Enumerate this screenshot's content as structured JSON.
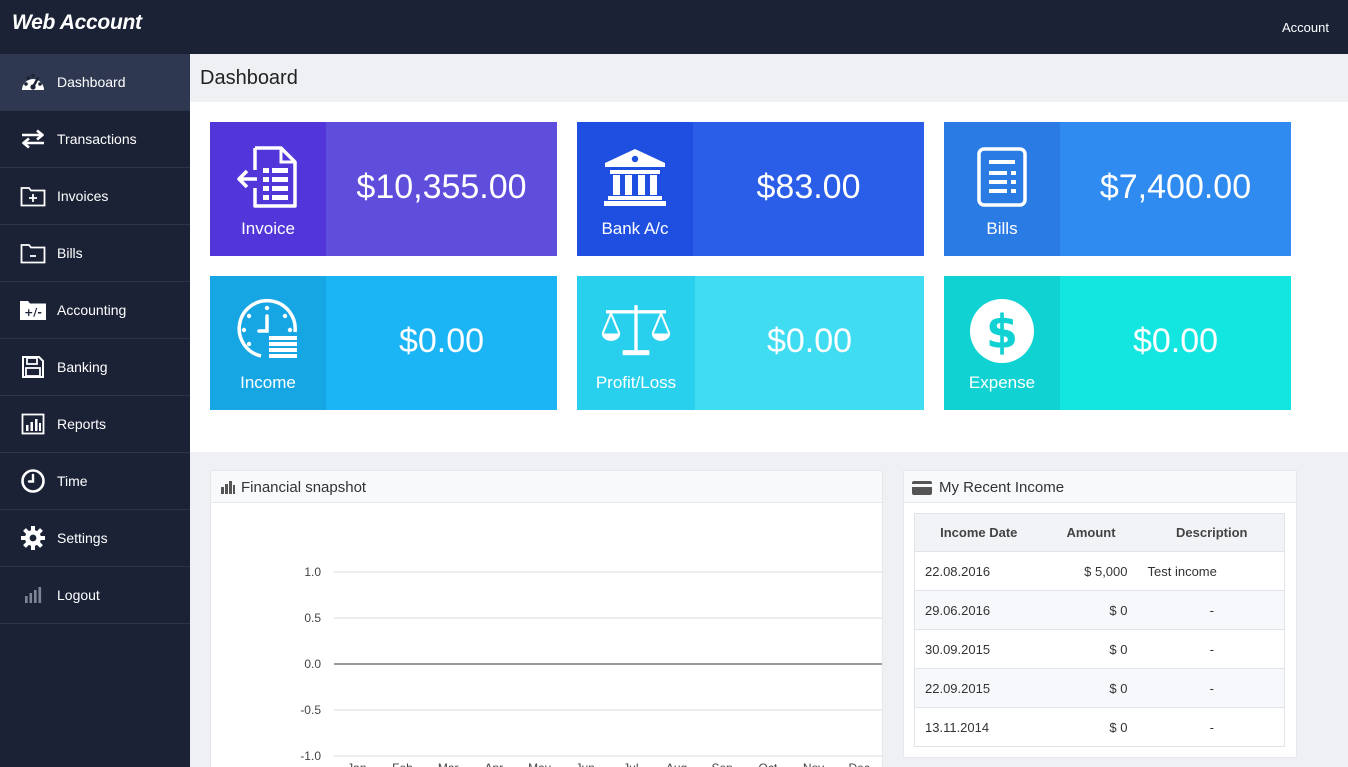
{
  "app": {
    "logo": "Web Account",
    "account_label": "Account"
  },
  "sidebar": {
    "items": [
      {
        "label": "Dashboard",
        "icon": "dashboard-gauge-icon",
        "active": true
      },
      {
        "label": "Transactions",
        "icon": "transfer-arrows-icon"
      },
      {
        "label": "Invoices",
        "icon": "folder-plus-icon"
      },
      {
        "label": "Bills",
        "icon": "folder-minus-icon"
      },
      {
        "label": "Accounting",
        "icon": "plus-minus-folder-icon"
      },
      {
        "label": "Banking",
        "icon": "floppy-disk-icon"
      },
      {
        "label": "Reports",
        "icon": "bar-chart-icon"
      },
      {
        "label": "Time",
        "icon": "clock-icon"
      },
      {
        "label": "Settings",
        "icon": "gear-icon"
      },
      {
        "label": "Logout",
        "icon": "signal-bars-icon"
      }
    ]
  },
  "page": {
    "title": "Dashboard"
  },
  "tiles": [
    {
      "label": "Invoice",
      "value": "$10,355.00",
      "icon": "invoice-document-icon",
      "left_color": "#5236d9",
      "right_color": "#5f4ddb"
    },
    {
      "label": "Bank A/c",
      "value": "$83.00",
      "icon": "bank-building-icon",
      "left_color": "#1f4fe0",
      "right_color": "#2a5ee8"
    },
    {
      "label": "Bills",
      "value": "$7,400.00",
      "icon": "bill-document-icon",
      "left_color": "#2b7be4",
      "right_color": "#2f8bf0"
    },
    {
      "label": "Income",
      "value": "$0.00",
      "icon": "clock-stack-icon",
      "left_color": "#17a6e4",
      "right_color": "#1bb5f6"
    },
    {
      "label": "Profit/Loss",
      "value": "$0.00",
      "icon": "balance-scale-icon",
      "left_color": "#29d0ee",
      "right_color": "#3fdcf2"
    },
    {
      "label": "Expense",
      "value": "$0.00",
      "icon": "dollar-coin-icon",
      "left_color": "#10d2d2",
      "right_color": "#13e6e0"
    }
  ],
  "snapshot": {
    "title": "Financial snapshot",
    "icon": "bar-chart-icon",
    "chart_data": {
      "type": "line",
      "y_ticks": [
        "1.0",
        "0.5",
        "0.0",
        "-0.5",
        "-1.0"
      ],
      "ylim": [
        -1.0,
        1.0
      ],
      "categories": [
        "Jan",
        "Feb",
        "Mar",
        "Apr",
        "May",
        "Jun",
        "Jul",
        "Aug",
        "Sep",
        "Oct",
        "Nov",
        "Dec"
      ],
      "series": [],
      "grid": true
    }
  },
  "income": {
    "title": "My Recent Income",
    "icon": "credit-card-icon",
    "headers": {
      "date": "Income Date",
      "amount": "Amount",
      "description": "Description"
    },
    "rows": [
      {
        "date": "22.08.2016",
        "amount": "$ 5,000",
        "description": "Test income"
      },
      {
        "date": "29.06.2016",
        "amount": "$ 0",
        "description": "-"
      },
      {
        "date": "30.09.2015",
        "amount": "$ 0",
        "description": "-"
      },
      {
        "date": "22.09.2015",
        "amount": "$ 0",
        "description": "-"
      },
      {
        "date": "13.11.2014",
        "amount": "$ 0",
        "description": "-"
      }
    ]
  }
}
